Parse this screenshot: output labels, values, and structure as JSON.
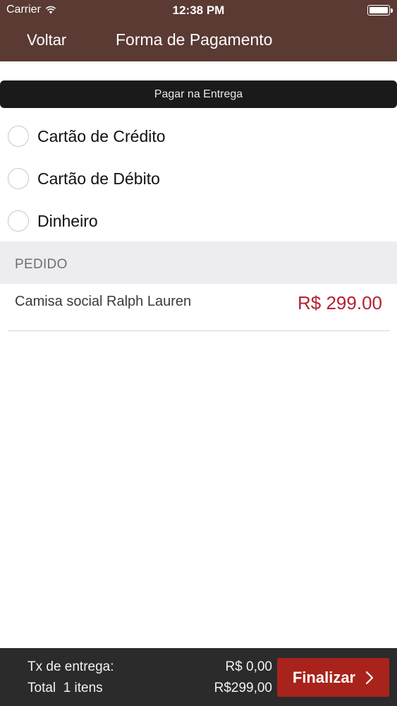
{
  "status_bar": {
    "carrier": "Carrier",
    "time": "12:38 PM",
    "icons": [
      "wifi-icon",
      "battery-icon"
    ]
  },
  "nav": {
    "back_label": "Voltar",
    "title": "Forma de Pagamento"
  },
  "pay_on_delivery": "Pagar na Entrega",
  "payment_options": [
    {
      "label": "Cartão de Crédito",
      "selected": false
    },
    {
      "label": "Cartão de Débito",
      "selected": false
    },
    {
      "label": "Dinheiro",
      "selected": false
    }
  ],
  "order": {
    "section_title": "PEDIDO",
    "items": [
      {
        "name": "Camisa social Ralph Lauren",
        "price": "R$ 299.00"
      }
    ]
  },
  "footer": {
    "fee_label": "Tx de entrega:",
    "fee_value": "R$ 0,00",
    "total_label": "Total",
    "total_count": "1 itens",
    "total_value": "R$299,00",
    "finalize_label": "Finalizar"
  },
  "colors": {
    "header_bg": "#5a3a33",
    "price": "#b52231",
    "finalize_bg": "#a8231b",
    "footer_bg": "#2b2b2b"
  }
}
